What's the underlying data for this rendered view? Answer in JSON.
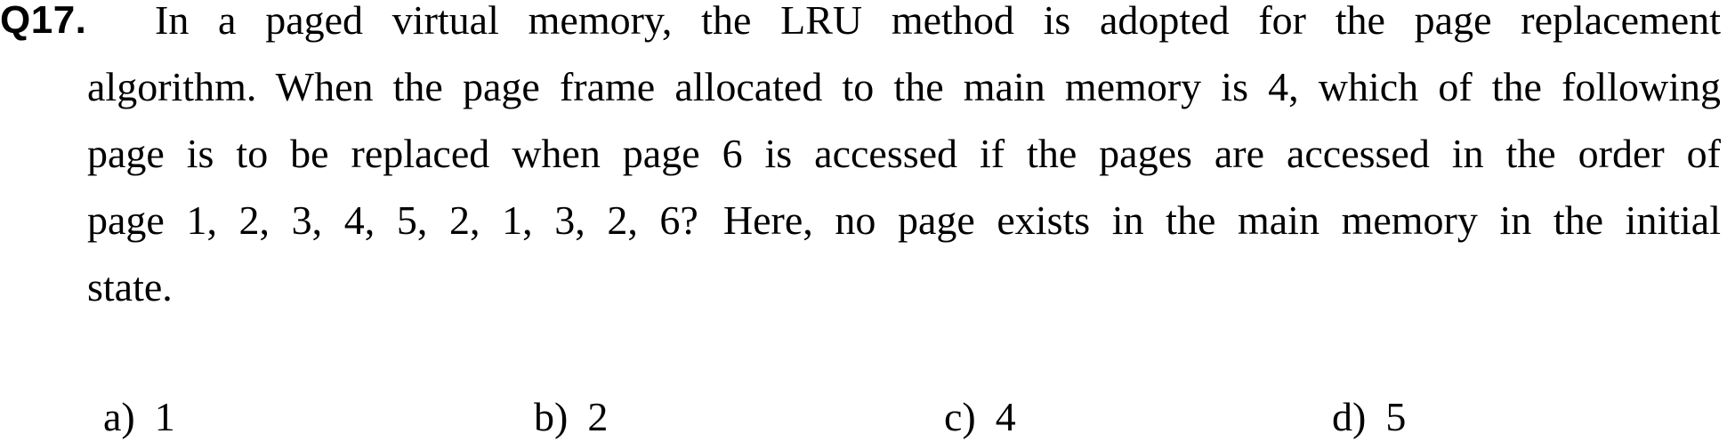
{
  "question": {
    "number": "Q17.",
    "lines": [
      "In a paged virtual memory, the LRU method is adopted for the page replacement",
      "algorithm. When the page frame allocated to the main memory is 4, which of the following",
      "page is to be replaced when page 6 is accessed if the pages are accessed in the order of",
      "page 1, 2, 3, 4, 5, 2, 1, 3, 2, 6?",
      "Here, no page exists in the main memory in the initial",
      "state."
    ]
  },
  "options": [
    {
      "letter": "a)",
      "value": "1"
    },
    {
      "letter": "b)",
      "value": "2"
    },
    {
      "letter": "c)",
      "value": "4"
    },
    {
      "letter": "d)",
      "value": "5"
    }
  ]
}
